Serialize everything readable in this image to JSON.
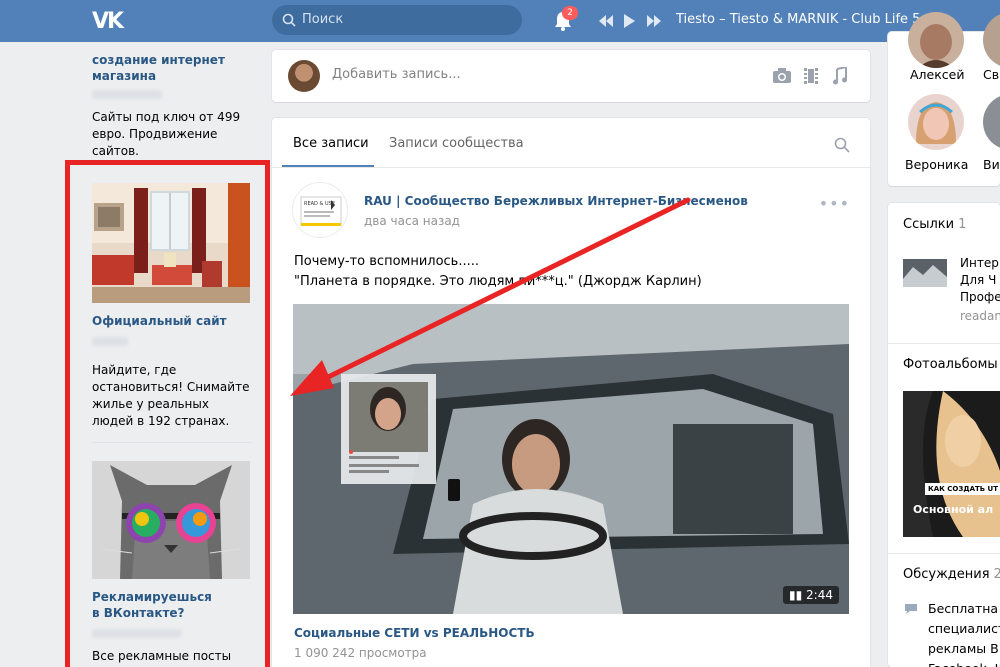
{
  "topbar": {
    "logo": "VK",
    "search_placeholder": "Поиск",
    "notifications_count": "2",
    "now_playing": "Tiesto – Tiesto & MARNIK - Club Life 5..."
  },
  "left_ads": {
    "ad0": {
      "title": "создание интернет магазина",
      "text": "Сайты под ключ от 499 евро. Продвижение сайтов."
    },
    "ad1": {
      "title": "Официальный сайт",
      "text": "Найдите, где остановиться! Снимайте жилье у реальных людей в 192 странах."
    },
    "ad2": {
      "title": "Рекламируешься в ВКонтакте?",
      "text": "Все рекламные посты здесь! Publer поможет"
    }
  },
  "post_box": {
    "placeholder": "Добавить запись..."
  },
  "feed": {
    "tabs": [
      "Все записи",
      "Записи сообщества"
    ],
    "post": {
      "author": "RAU | Сообщество Бережливых Интернет-Бизнесменов",
      "time": "два часа назад",
      "text_line1": "Почему-то вспомнилось.....",
      "text_line2": "\"Планета в порядке. Это людям пи***ц.\" (Джордж Карлин)",
      "logo_text": "READ & USE",
      "video": {
        "duration": "2:44",
        "title": "Социальные СЕТИ vs РЕАЛЬНОСТЬ",
        "views": "1 090 242 просмотра"
      }
    }
  },
  "right": {
    "friends": [
      "Алексей",
      "Св",
      "Вероника",
      "Ви"
    ],
    "links": {
      "header": "Ссылки",
      "count": "1",
      "line1": "Интер",
      "line2": "Для Ч",
      "line3": "Профе",
      "domain": "readan"
    },
    "albums": {
      "header": "Фотоальбомы",
      "overlay_top": "КАК СОЗДАТЬ UT",
      "overlay_bottom": "Основной ал"
    },
    "discussions": {
      "header": "Обсуждения",
      "count": "2",
      "line1": "Бесплатна",
      "line2": "специалист",
      "line3": "рекламы В",
      "line4": "Facebook, I"
    }
  },
  "colors": {
    "brand": "#5181b8",
    "link": "#2a5885",
    "highlight": "#e82424"
  }
}
